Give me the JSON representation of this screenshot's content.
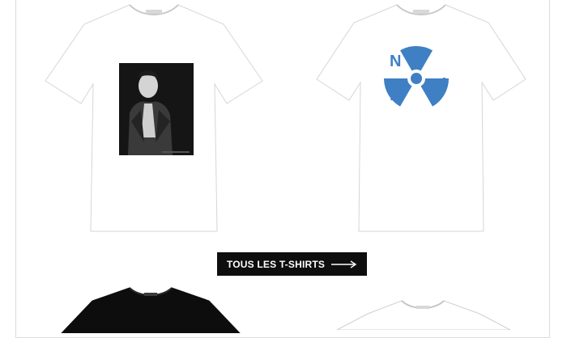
{
  "products": [
    {
      "name": "T-shirt photo portrait",
      "color": "#ffffff",
      "print": "photo-portrait"
    },
    {
      "name": "T-shirt radiation symbol",
      "color": "#ffffff",
      "print": "radiation-symbol",
      "print_text": [
        "N",
        "N",
        "!"
      ],
      "print_color": "#3f7fc4"
    },
    {
      "name": "T-shirt black",
      "color": "#0d0d0d"
    },
    {
      "name": "T-shirt white",
      "color": "#ffffff"
    }
  ],
  "cta": {
    "label": "TOUS LES T-SHIRTS",
    "icon": "arrow-right-icon"
  }
}
